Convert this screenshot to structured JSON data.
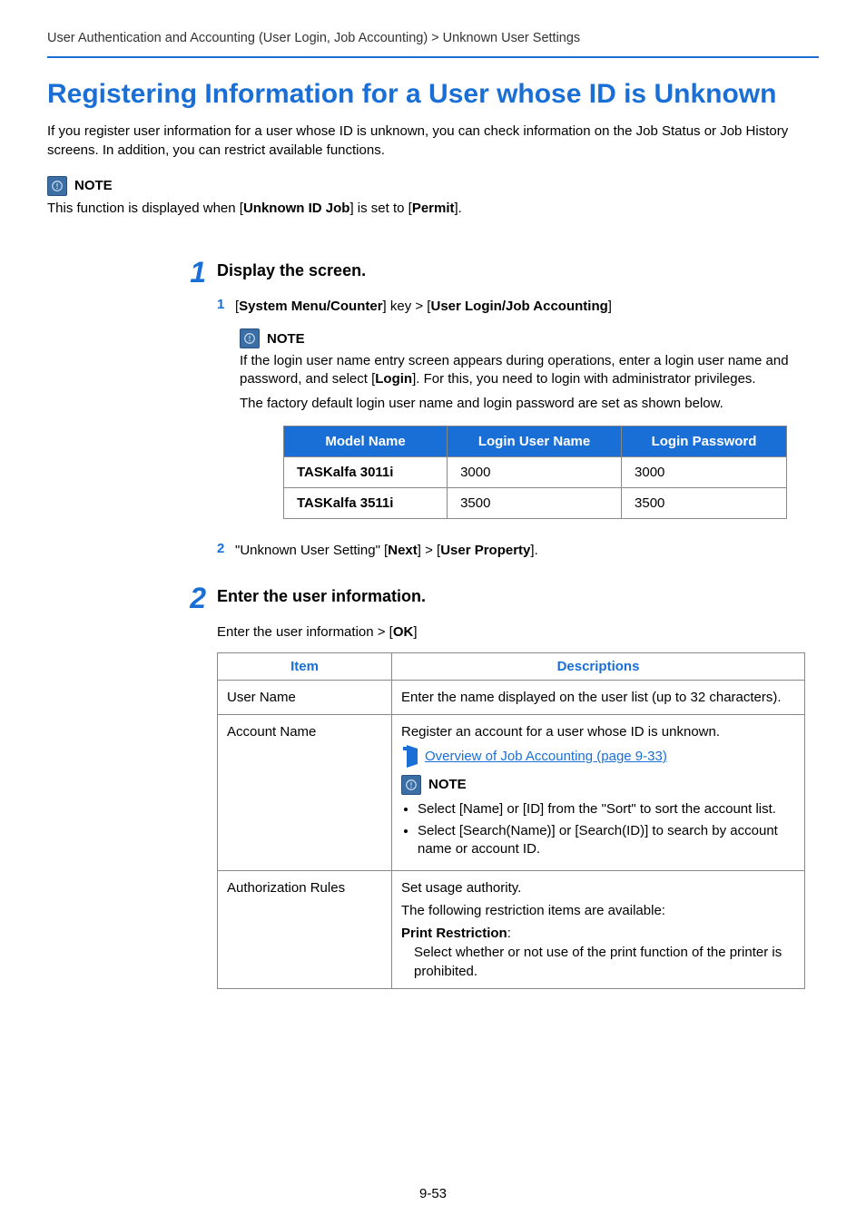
{
  "breadcrumb": "User Authentication and Accounting (User Login, Job Accounting) > Unknown User Settings",
  "title": "Registering Information for a User whose ID is Unknown",
  "intro": "If you register user information for a user whose ID is unknown, you can check information on the Job Status or Job History screens. In addition, you can restrict available functions.",
  "note1": {
    "label": "NOTE",
    "body_pre": "This function is displayed when [",
    "body_b1": "Unknown ID Job",
    "body_mid": "] is set to [",
    "body_b2": "Permit",
    "body_post": "]."
  },
  "step1": {
    "num": "1",
    "title": "Display the screen.",
    "sub1": {
      "num": "1",
      "pre": "[",
      "b1": "System Menu/Counter",
      "mid": "] key > [",
      "b2": "User Login/Job Accounting",
      "post": "]"
    },
    "note": {
      "label": "NOTE",
      "p1_pre": "If the login user name entry screen appears during operations, enter a login user name and password, and select [",
      "p1_b": "Login",
      "p1_post": "]. For this, you need to login with administrator privileges.",
      "p2": "The factory default login user name and login password are set as shown below."
    },
    "login_table": {
      "headers": [
        "Model Name",
        "Login User Name",
        "Login Password"
      ],
      "rows": [
        [
          "TASKalfa 3011i",
          "3000",
          "3000"
        ],
        [
          "TASKalfa 3511i",
          "3500",
          "3500"
        ]
      ]
    },
    "sub2": {
      "num": "2",
      "pre": "\"Unknown User Setting\" [",
      "b1": "Next",
      "mid": "] > [",
      "b2": "User Property",
      "post": "]."
    }
  },
  "step2": {
    "num": "2",
    "title": "Enter the user information.",
    "lead_pre": "Enter the user information > [",
    "lead_b": "OK",
    "lead_post": "]",
    "table": {
      "headers": [
        "Item",
        "Descriptions"
      ],
      "rows": {
        "r1": {
          "item": "User Name",
          "desc": "Enter the name displayed on the user list (up to 32 characters)."
        },
        "r2": {
          "item": "Account Name",
          "desc_line": "Register an account for a user whose ID is unknown.",
          "xref": "Overview of Job Accounting (page 9-33)",
          "note_label": "NOTE",
          "bullets": [
            "Select [Name] or [ID] from the \"Sort\" to sort the account list.",
            "Select [Search(Name)] or [Search(ID)] to search by account name or account ID."
          ]
        },
        "r3": {
          "item": "Authorization Rules",
          "line1": "Set usage authority.",
          "line2": "The following restriction items are available:",
          "pr_label": "Print Restriction",
          "pr_desc": "Select whether or not use of the print function of the printer is prohibited."
        }
      }
    }
  },
  "pagenum": "9-53"
}
